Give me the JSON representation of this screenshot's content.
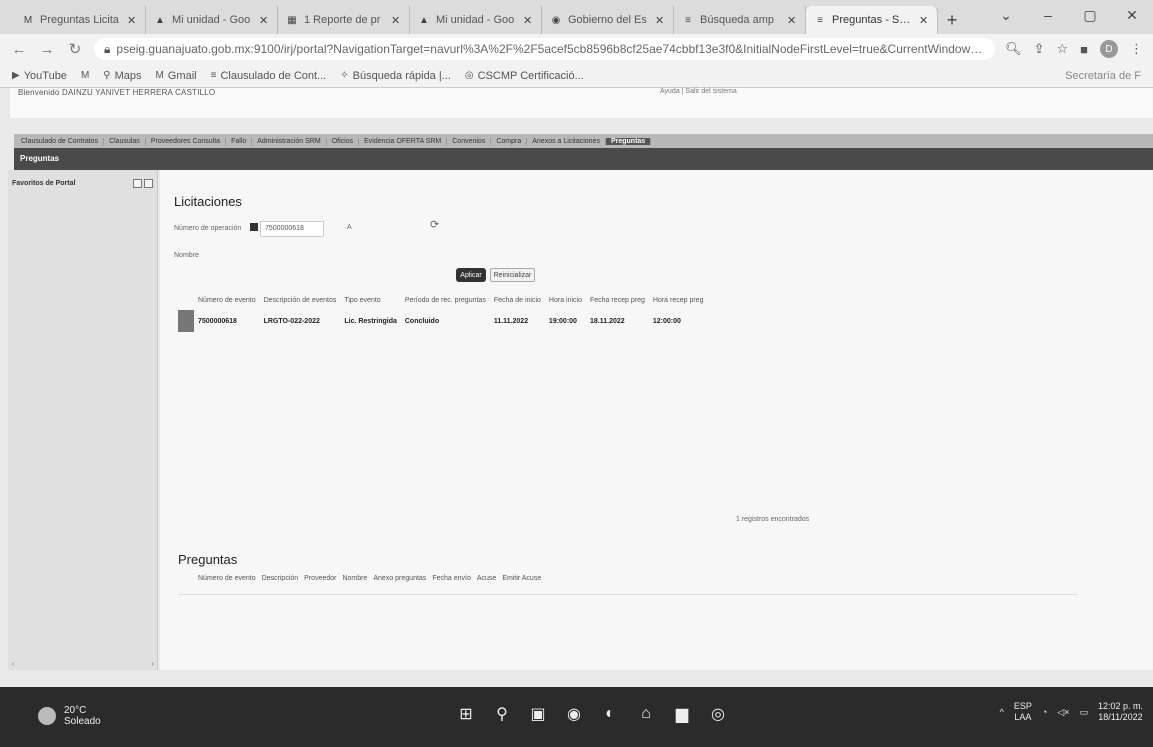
{
  "browser": {
    "tabs": [
      {
        "label": "Preguntas Licita",
        "icon": "gmail-icon"
      },
      {
        "label": "Mi unidad - Goo",
        "icon": "drive-icon"
      },
      {
        "label": "1 Reporte de pr",
        "icon": "sheets-icon"
      },
      {
        "label": "Mi unidad - Goo",
        "icon": "drive-icon"
      },
      {
        "label": "Gobierno del Es",
        "icon": "globe-icon"
      },
      {
        "label": "Búsqueda amp",
        "icon": "sap-icon"
      },
      {
        "label": "Preguntas - SAP",
        "icon": "sap-icon"
      }
    ],
    "url": "pseig.guanajuato.gob.mx:9100/irj/portal?NavigationTarget=navurl%3A%2F%2F5acef5cb8596b8cf25ae74cbbf13e3f0&InitialNodeFirstLevel=true&CurrentWindowId...",
    "bookmarks": [
      "YouTube",
      "Maps",
      "Gmail",
      "Clausulado de Cont...",
      "Búsqueda rápida |...",
      "CSCMP Certificació..."
    ],
    "bookmark_right": "Secretaría de F",
    "profile_letter": "D"
  },
  "portal": {
    "welcome": "Bienvenido DAINZU YANIVET HERRERA CASTILLO",
    "top_links": "Ayuda | Salir del sistema",
    "menu": [
      "Clausulado de Contratos",
      "Clausulas",
      "Proveedores Consulta",
      "Fallo",
      "Administración SRM",
      "Oficios",
      "Evidencia OFERTA SRM",
      "Convenios",
      "Compra",
      "Anexos a Licitaciones",
      "Preguntas"
    ],
    "subheader": "Preguntas",
    "left_panel_title": "Favoritos de Portal"
  },
  "licitaciones": {
    "title": "Licitaciones",
    "operation_label": "Número de operación",
    "operation_value": "7500000618",
    "to_label": "A",
    "name_label": "Nombre",
    "apply_button": "Aplicar",
    "reset_button": "Reinicializar",
    "columns": [
      "Número de evento",
      "Descripción de eventos",
      "Tipo evento",
      "Período de rec. preguntas",
      "Fecha de inicio",
      "Hora inicio",
      "Fecha recep preg",
      "Hora recep preg"
    ],
    "rows": [
      [
        "7500000618",
        "LRGTO-022-2022",
        "Lic. Restringida",
        "Concluido",
        "11.11.2022",
        "19:00:00",
        "18.11.2022",
        "12:00:00"
      ]
    ],
    "records_found": "1 registros encontrados"
  },
  "preguntas": {
    "title": "Preguntas",
    "columns": [
      "Número de evento",
      "Descripción",
      "Proveedor",
      "Nombre",
      "Anexo preguntas",
      "Fecha envío",
      "Acuse",
      "Emitir Acuse"
    ]
  },
  "taskbar": {
    "temperature": "20°C",
    "weather": "Soleado",
    "lang_top": "ESP",
    "lang_bottom": "LAA",
    "time": "12:02 p. m.",
    "date": "18/11/2022"
  }
}
